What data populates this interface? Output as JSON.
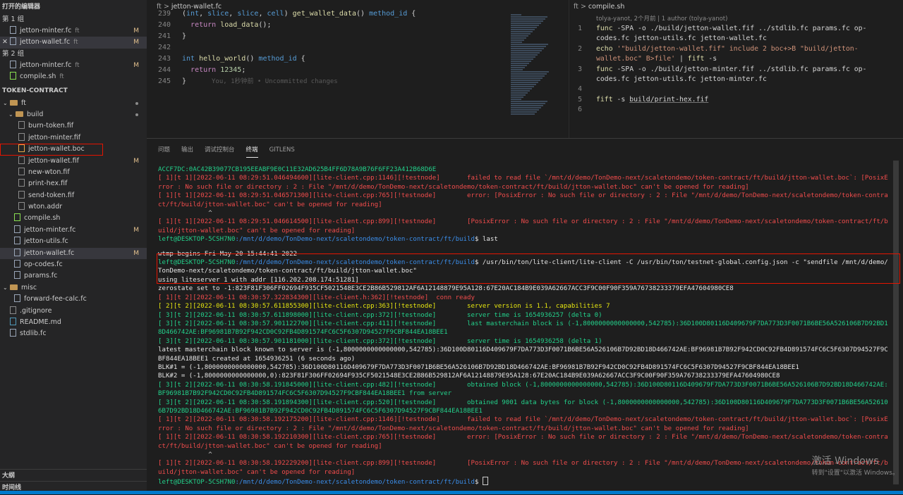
{
  "sidebar": {
    "open_editors_title": "打开的编辑器",
    "groups": [
      {
        "label": "第 1 组",
        "files": [
          {
            "name": "jetton-minter.fc",
            "dir": "ft",
            "status": "M",
            "active": false,
            "closable": false
          },
          {
            "name": "jetton-wallet.fc",
            "dir": "ft",
            "status": "M",
            "active": true,
            "closable": true
          }
        ]
      },
      {
        "label": "第 2 组",
        "files": [
          {
            "name": "jetton-minter.fc",
            "dir": "ft",
            "status": "M",
            "active": false,
            "closable": false
          },
          {
            "name": "compile.sh",
            "dir": "ft",
            "status": "",
            "active": false,
            "closable": false
          }
        ]
      }
    ],
    "project_title": "TOKEN-CONTRACT",
    "tree_ft": "ft",
    "tree_build": "build",
    "build_files": [
      {
        "name": "burn-token.fif",
        "status": ""
      },
      {
        "name": "jetton-minter.fif",
        "status": ""
      },
      {
        "name": "jetton-wallet.boc",
        "status": "M",
        "boxed": true
      },
      {
        "name": "jetton-wallet.fif",
        "status": "M"
      },
      {
        "name": "new-wton.fif",
        "status": ""
      },
      {
        "name": "print-hex.fif",
        "status": ""
      },
      {
        "name": "send-token.fif",
        "status": ""
      },
      {
        "name": "wton.addr",
        "status": ""
      }
    ],
    "ft_files": [
      {
        "name": "compile.sh",
        "status": "",
        "active": false
      },
      {
        "name": "jetton-minter.fc",
        "status": "M",
        "active": false
      },
      {
        "name": "jetton-utils.fc",
        "status": "",
        "active": false
      },
      {
        "name": "jetton-wallet.fc",
        "status": "M",
        "active": true
      },
      {
        "name": "op-codes.fc",
        "status": "",
        "active": false
      },
      {
        "name": "params.fc",
        "status": "",
        "active": false
      }
    ],
    "tree_misc": "misc",
    "misc_files": [
      "forward-fee-calc.fc"
    ],
    "root_files": [
      ".gitignore",
      "README.md",
      "stdlib.fc"
    ],
    "outline_title": "大纲",
    "timeline_title": "时间线"
  },
  "editor1": {
    "crumb": "ft",
    "file": "jetton-wallet.fc",
    "lines": [
      {
        "n": "239",
        "code": "(int, slice, slice, cell) get_wallet_data() method_id {"
      },
      {
        "n": "240",
        "code": "  return load_data();"
      },
      {
        "n": "241",
        "code": "}"
      },
      {
        "n": "242",
        "code": ""
      },
      {
        "n": "243",
        "code": "int hello_world() method_id {"
      },
      {
        "n": "244",
        "code": "  return 12345;"
      },
      {
        "n": "245",
        "code": "}"
      }
    ],
    "blame": "You, 1秒钟前 • Uncommitted changes"
  },
  "editor2": {
    "crumb": "ft",
    "file": "compile.sh",
    "blame": "tolya-yanot, 2个月前 | 1 author (tolya-yanot)",
    "lines": [
      {
        "n": "1",
        "code": "func -SPA -o ./build/jetton-wallet.fif ../stdlib.fc params.fc op-codes.fc jetton-utils.fc jetton-wallet.fc"
      },
      {
        "n": "2",
        "code": "echo '\"build/jetton-wallet.fif\" include 2 boc+>B \"build/jetton-wallet.boc\" B>file' | fift -s"
      },
      {
        "n": "3",
        "code": "func -SPA -o ./build/jetton-minter.fif ../stdlib.fc params.fc op-codes.fc jetton-utils.fc jetton-minter.fc"
      },
      {
        "n": "4",
        "code": ""
      },
      {
        "n": "5",
        "code": "fift -s build/print-hex.fif"
      },
      {
        "n": "6",
        "code": ""
      }
    ]
  },
  "panel": {
    "tabs": [
      "问题",
      "输出",
      "调试控制台",
      "终端",
      "GITLENS"
    ],
    "active_tab": "终端",
    "terminal": [
      {
        "c": "t-green",
        "t": "ACCF7DC:0AC42B39077CB195EEABF9E0C11E32AD625B4FF6D78A9B76F6FF23A412B68D6E"
      },
      {
        "c": "t-red",
        "t": "[ 1][t 1][2022-06-11 08:29:51.046494600][lite-client.cpp:1146][!testnode]       failed to read file `/mnt/d/demo/TonDemo-next/scaletondemo/token-contract/ft/build/jtton-wallet.boc`: [PosixError : No such file or directory : 2 : File \"/mnt/d/demo/TonDemo-next/scaletondemo/token-contract/ft/build/jtton-wallet.boc\" can't be opened for reading]"
      },
      {
        "c": "t-red",
        "t": "[ 1][t 1][2022-06-11 08:29:51.046571300][lite-client.cpp:765][!testnode]        error: [PosixError : No such file or directory : 2 : File \"/mnt/d/demo/TonDemo-next/scaletondemo/token-contract/ft/build/jtton-wallet.boc\" can't be opened for reading]"
      },
      {
        "c": "t-gray",
        "t": "             ^"
      },
      {
        "c": "t-red",
        "t": "[ 1][t 1][2022-06-11 08:29:51.046614500][lite-client.cpp:899][!testnode]        [PosixError : No such file or directory : 2 : File \"/mnt/d/demo/TonDemo-next/scaletondemo/token-contract/ft/build/jtton-wallet.boc\" can't be opened for reading]"
      },
      {
        "c": "prompt",
        "user": "left@DESKTOP-5CSH7N0",
        "path": ":/mnt/d/demo/TonDemo-next/scaletondemo/token-contract/ft/build",
        "t": "$ last"
      },
      {
        "c": "gap",
        "t": ""
      },
      {
        "c": "t-white",
        "t": "wtmp begins Fri May 20 15:44:41 2022"
      },
      {
        "c": "prompt",
        "user": "left@DESKTOP-5CSH7N0",
        "path": ":/mnt/d/demo/TonDemo-next/scaletondemo/token-contract/ft/build",
        "t": "$ /usr/bin/ton/lite-client/lite-client -C /usr/bin/ton/testnet-global.config.json -c \"sendfile /mnt/d/demo/TonDemo-next/scaletondemo/token-contract/ft/build/jtton-wallet.boc\""
      },
      {
        "c": "t-white",
        "t": "using liteserver 1 with addr [116.202.208.174:51281]"
      },
      {
        "c": "t-white",
        "t": "zerostate set to -1:823F81F306FF02694F935CF5021548E3CE2B86B529812AF6A12148879E95A128:67E20AC184B9E039A62667ACC3F9C00F90F359A76738233379EFA47604980CE8"
      },
      {
        "c": "t-red",
        "t": "[ 1][t 2][2022-06-11 08:30:57.322834300][lite-client.h:362][!testnode]  conn ready"
      },
      {
        "c": "t-yellow",
        "t": "[ 2][t 2][2022-06-11 08:30:57.611855300][lite-client.cpp:363][!testnode]        server version is 1.1, capabilities 7"
      },
      {
        "c": "t-green",
        "t": "[ 3][t 2][2022-06-11 08:30:57.611898000][lite-client.cpp:372][!testnode]        server time is 1654936257 (delta 0)"
      },
      {
        "c": "t-green",
        "t": "[ 3][t 2][2022-06-11 08:30:57.901122700][lite-client.cpp:411][!testnode]        last masterchain block is (-1,8000000000000000,542785):36D100D80116D409679F7DA773D3F0071B6BE56A526106B7D92BD18D466742AE:BF96981B7B92F942CD0C92FB4D891574FC6C5F6307D94527F9CBF844EA18BEE1"
      },
      {
        "c": "t-green",
        "t": "[ 3][t 2][2022-06-11 08:30:57.901181000][lite-client.cpp:372][!testnode]        server time is 1654936258 (delta 1)"
      },
      {
        "c": "t-white",
        "t": "latest masterchain block known to server is (-1,8000000000000000,542785):36D100D80116D409679F7DA773D3F0071B6BE56A526106B7D92BD18D466742AE:BF96981B7B92F942CD0C92FB4D891574FC6C5F6307D94527F9CBF844EA18BEE1 created at 1654936251 (6 seconds ago)"
      },
      {
        "c": "t-white",
        "t": "BLK#1 = (-1,8000000000000000,542785):36D100D80116D409679F7DA773D3F0071B6BE56A526106B7D92BD18D466742AE:BF96981B7B92F942CD0C92FB4D891574FC6C5F6307D94527F9CBF844EA18BEE1"
      },
      {
        "c": "t-white",
        "t": "BLK#2 = (-1,8000000000000000,0):823F81F306FF02694F935CF5021548E3CE2B86B529812AF6A12148879E95A128:67E20AC184B9E039A62667ACC3F9C00F90F359A76738233379EFA47604980CE8"
      },
      {
        "c": "t-green",
        "t": "[ 3][t 2][2022-06-11 08:30:58.191845000][lite-client.cpp:482][!testnode]        obtained block (-1,8000000000000000,542785):36D100D80116D409679F7DA773D3F0071B6BE56A526106B7D92BD18D466742AE:BF96981B7B92F942CD0C92FB4D891574FC6C5F6307D94527F9CBF844EA18BEE1 from server"
      },
      {
        "c": "t-green",
        "t": "[ 3][t 2][2022-06-11 08:30:58.191894300][lite-client.cpp:520][!testnode]        obtained 9001 data bytes for block (-1,8000000000000000,542785):36D100D80116D409679F7DA773D3F0071B6BE56A526106B7D92BD18D466742AE:BF96981B7B92F942CD0C92FB4D891574FC6C5F6307D94527F9CBF844EA18BEE1"
      },
      {
        "c": "t-red",
        "t": "[ 1][t 2][2022-06-11 08:30:58.192175200][lite-client.cpp:1146][!testnode]       failed to read file `/mnt/d/demo/TonDemo-next/scaletondemo/token-contract/ft/build/jtton-wallet.boc`: [PosixError : No such file or directory : 2 : File \"/mnt/d/demo/TonDemo-next/scaletondemo/token-contract/ft/build/jtton-wallet.boc\" can't be opened for reading]"
      },
      {
        "c": "t-red",
        "t": "[ 1][t 2][2022-06-11 08:30:58.192210300][lite-client.cpp:765][!testnode]        error: [PosixError : No such file or directory : 2 : File \"/mnt/d/demo/TonDemo-next/scaletondemo/token-contract/ft/build/jtton-wallet.boc\" can't be opened for reading]"
      },
      {
        "c": "t-gray",
        "t": "             ^"
      },
      {
        "c": "t-red",
        "t": "[ 1][t 2][2022-06-11 08:30:58.192229200][lite-client.cpp:899][!testnode]        [PosixError : No such file or directory : 2 : File \"/mnt/d/demo/TonDemo-next/scaletondemo/token-contract/ft/build/jtton-wallet.boc\" can't be opened for reading]"
      },
      {
        "c": "prompt-cursor",
        "user": "left@DESKTOP-5CSH7N0",
        "path": ":/mnt/d/demo/TonDemo-next/scaletondemo/token-contract/ft/build",
        "t": "$ "
      }
    ]
  },
  "watermark": {
    "line1": "激活 Windows",
    "line2": "转到\"设置\"以激活 Windows。"
  }
}
